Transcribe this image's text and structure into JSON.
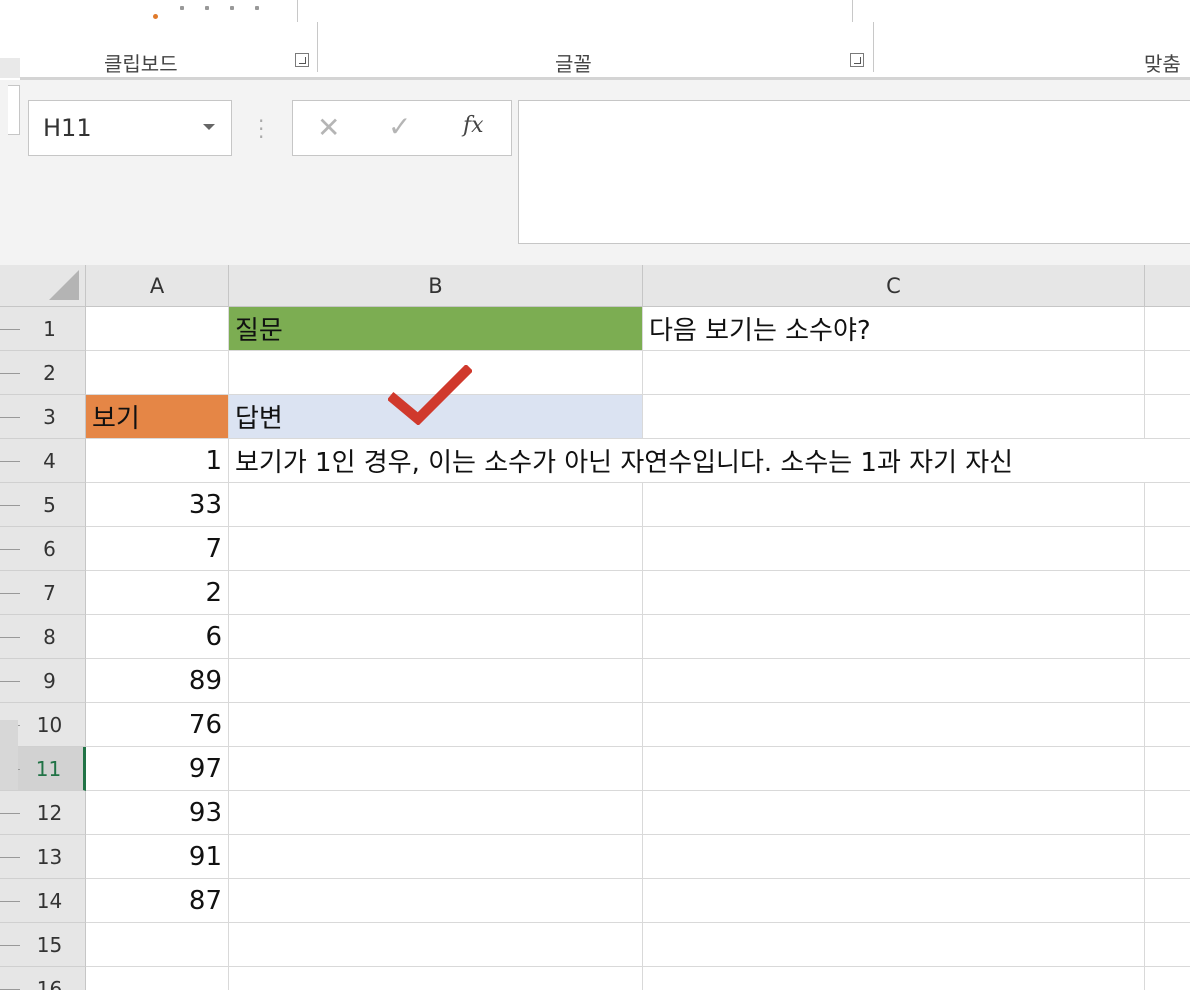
{
  "ribbon": {
    "groups": [
      {
        "label": "클립보드"
      },
      {
        "label": "글꼴"
      },
      {
        "label": "맞춤"
      }
    ]
  },
  "formula_bar": {
    "name_box": "H11",
    "cancel_glyph": "✕",
    "enter_glyph": "✓",
    "fx_label": "fx",
    "formula": ""
  },
  "sheet": {
    "columns": [
      "A",
      "B",
      "C"
    ],
    "rows": [
      "1",
      "2",
      "3",
      "4",
      "5",
      "6",
      "7",
      "8",
      "9",
      "10",
      "11",
      "12",
      "13",
      "14",
      "15",
      "16"
    ],
    "active_row": "11",
    "cells": {
      "B1": "질문",
      "C1": "다음 보기는 소수야?",
      "A3": "보기",
      "B3": "답변",
      "A4": "1",
      "B4": "보기가 1인 경우, 이는 소수가 아닌 자연수입니다. 소수는 1과 자기 자신",
      "A5": "33",
      "A6": "7",
      "A7": "2",
      "A8": "6",
      "A9": "89",
      "A10": "76",
      "A11": "97",
      "A12": "93",
      "A13": "91",
      "A14": "87"
    },
    "fills": {
      "B1": "#7cad52",
      "A3": "#e58646",
      "B3": "#dbe3f2"
    },
    "annotation_color": "#d0392c"
  }
}
